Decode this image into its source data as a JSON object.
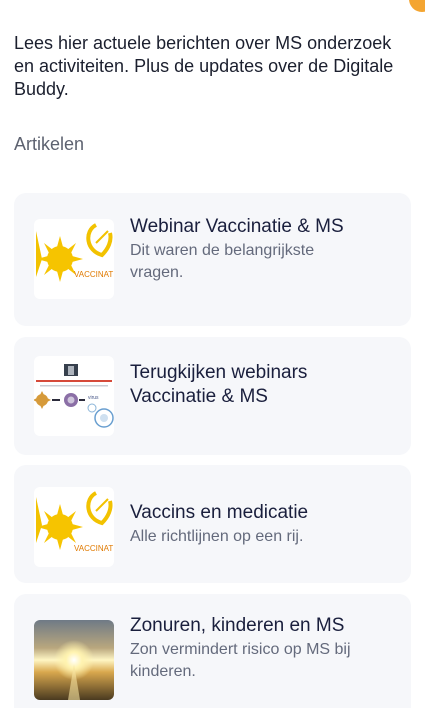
{
  "intro_text": "Lees hier actuele berichten over MS onderzoek en activiteiten. Plus de updates over de Digitale Buddy.",
  "section_label": "Artikelen",
  "articles": [
    {
      "title": "Webinar Vaccinatie & MS",
      "subtitle": "Dit waren de belangrijkste vragen.",
      "thumb_text": "VACCINATIE"
    },
    {
      "title": "Terugkijken webinars Vaccinatie & MS",
      "subtitle": ""
    },
    {
      "title": "Vaccins en medicatie",
      "subtitle": "Alle richtlijnen op een rij.",
      "thumb_text": "VACCINATIE"
    },
    {
      "title": "Zonuren, kinderen en MS",
      "subtitle": "Zon vermindert risico op MS bij kinderen."
    }
  ],
  "colors": {
    "accent": "#f4a531",
    "card_bg": "#f6f7fa",
    "title": "#1a1f3d",
    "subtitle": "#646a7c"
  }
}
